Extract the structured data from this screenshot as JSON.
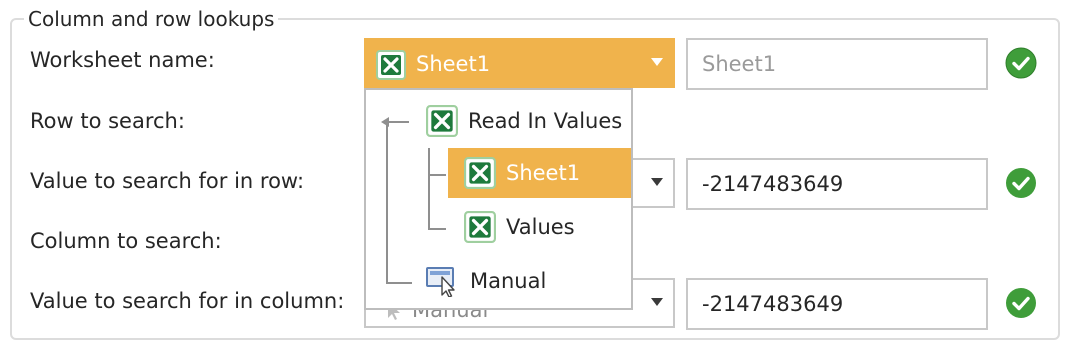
{
  "group": {
    "legend": "Column and row lookups"
  },
  "fields": {
    "worksheet_label": "Worksheet name:",
    "row_label": "Row to search:",
    "row_value_label": "Value to search for in row:",
    "column_label": "Column to search:",
    "column_value_label": "Value to search for in column:"
  },
  "worksheet": {
    "selected": "Sheet1",
    "text_placeholder": "Sheet1"
  },
  "row_value": {
    "text": "-2147483649"
  },
  "column_value": {
    "text": "-2147483649",
    "hidden_selected": "Manual"
  },
  "dropdown": {
    "root": "Read In Values",
    "children": [
      "Sheet1",
      "Values"
    ],
    "manual": "Manual"
  },
  "colors": {
    "accent": "#f0b34c",
    "ok": "#3f9d3a",
    "excel": "#1e7a3c"
  },
  "icons": [
    "excel-icon",
    "check-icon",
    "chevron-down-icon",
    "manual-cursor-icon",
    "tree-arrow-icon"
  ]
}
